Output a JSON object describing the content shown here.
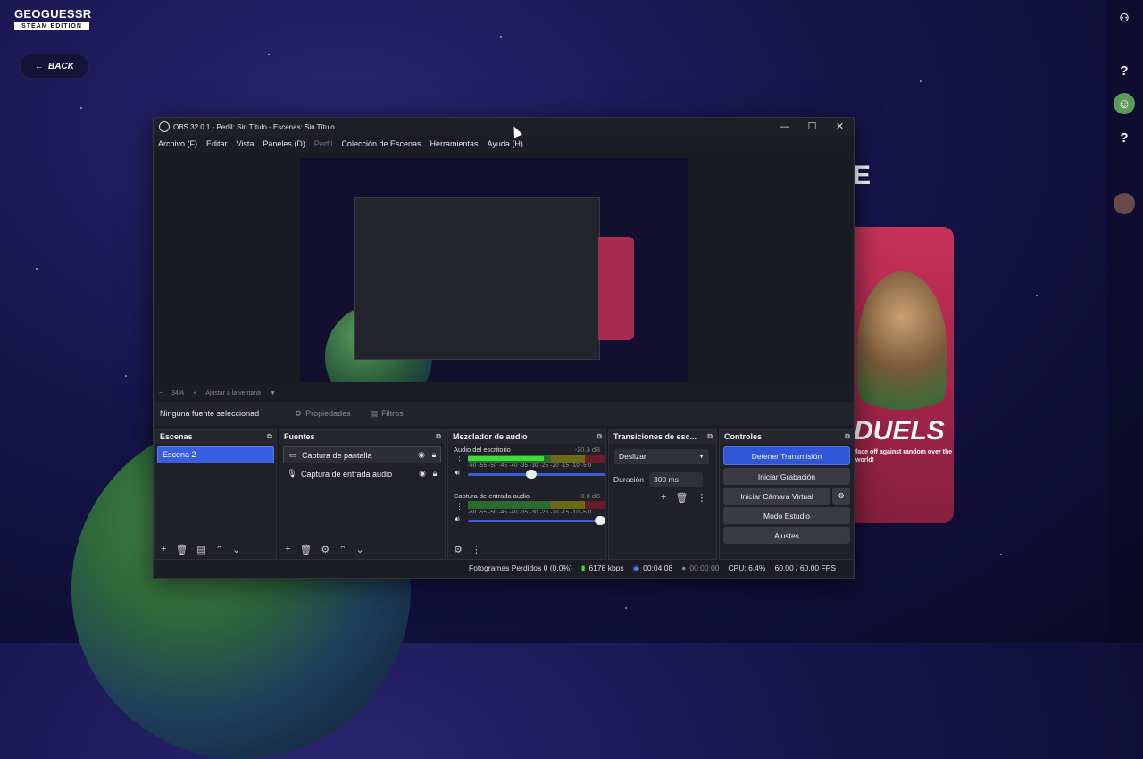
{
  "game": {
    "logo_title": "GEOGUESSR",
    "logo_edition": "STEAM EDITION",
    "back_label": "BACK",
    "duels_title": "DUELS",
    "duels_subtitle": "face off against random over the world!",
    "partial_heading": "E",
    "rail_icons": [
      "friends-icon",
      "help-icon",
      "avatar-icon",
      "help-icon",
      "avatar-icon"
    ]
  },
  "obs": {
    "title": "OBS 32.0.1 - Perfil: Sin Título - Escenas: Sin Título",
    "window_controls": {
      "minimize": "—",
      "maximize": "☐",
      "close": "✕"
    },
    "menu": [
      {
        "label": "Archivo (F)",
        "enabled": true
      },
      {
        "label": "Editar",
        "enabled": true
      },
      {
        "label": "Vista",
        "enabled": true
      },
      {
        "label": "Paneles (D)",
        "enabled": true
      },
      {
        "label": "Perfil",
        "enabled": false
      },
      {
        "label": "Colección de Escenas",
        "enabled": true
      },
      {
        "label": "Herramientas",
        "enabled": true
      },
      {
        "label": "Ayuda (H)",
        "enabled": true
      }
    ],
    "zoom": {
      "minus": "−",
      "value": "34%",
      "plus": "+",
      "fit_label": "Ajustar a la ventana"
    },
    "source_toolbar": {
      "no_source": "Ninguna fuente seleccionad",
      "properties": "Propiedades",
      "filters": "Filtros"
    },
    "scenes": {
      "title": "Escenas",
      "items": [
        "Escena 2"
      ]
    },
    "sources": {
      "title": "Fuentes",
      "items": [
        {
          "name": "Captura de pantalla",
          "icon": "monitor-icon"
        },
        {
          "name": "Captura de entrada audio",
          "icon": "microphone-icon"
        }
      ]
    },
    "mixer": {
      "title": "Mezclador de audio",
      "scale": "-60 -55 -50 -45 -40 -35 -30 -25 -20 -15 -10 -5 0",
      "channels": [
        {
          "name": "Audio del escritorio",
          "db": "-20.3 dB",
          "level": 0.55,
          "volume": 0.5
        },
        {
          "name": "Captura de entrada audio",
          "db": "0.0 dB",
          "level": 0.0,
          "volume": 1.0
        }
      ]
    },
    "transitions": {
      "title": "Transiciones de esc...",
      "selected": "Deslizar",
      "duration_label": "Duración",
      "duration_value": "300 ms"
    },
    "controls": {
      "title": "Controles",
      "stop_stream": "Detener Transmisión",
      "start_recording": "Iniciar Grabación",
      "start_virtual_cam": "Iniciar Cámara Virtual",
      "studio_mode": "Modo Estudio",
      "settings": "Ajustes"
    },
    "status": {
      "dropped_frames": "Fotogramas Perdidos 0 (0.0%)",
      "bitrate": "6178 kbps",
      "stream_time": "00:04:08",
      "record_time": "00:00:00",
      "cpu": "CPU: 6.4%",
      "fps": "60.00 / 60.00 FPS"
    }
  }
}
